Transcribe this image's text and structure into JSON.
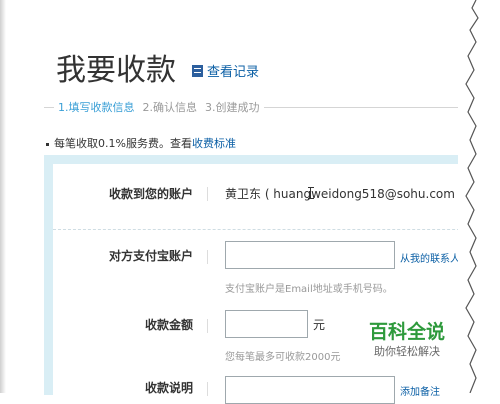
{
  "page": {
    "title": "我要收款",
    "record_link": "查看记录"
  },
  "steps": [
    {
      "label": "1.填写收款信息",
      "active": true
    },
    {
      "label": "2.确认信息",
      "active": false
    },
    {
      "label": "3.创建成功",
      "active": false
    }
  ],
  "notice": {
    "text": "每笔收取0.1%服务费。查看",
    "link": "收费标准"
  },
  "form": {
    "account_label": "收款到您的账户",
    "account_value": "黄卫东 ( huangweidong518@sohu.com",
    "payer_label": "对方支付宝账户",
    "payer_value": "",
    "payer_link": "从我的联系人",
    "payer_hint": "支付宝账户是Email地址或手机号码。",
    "amount_label": "收款金额",
    "amount_value": "",
    "amount_unit": "元",
    "amount_hint": "您每笔最多可收款2000元",
    "desc_label": "收款说明",
    "desc_link": "添加备注"
  },
  "watermark": {
    "title": "百科全说",
    "subtitle": "助你轻松解决"
  }
}
